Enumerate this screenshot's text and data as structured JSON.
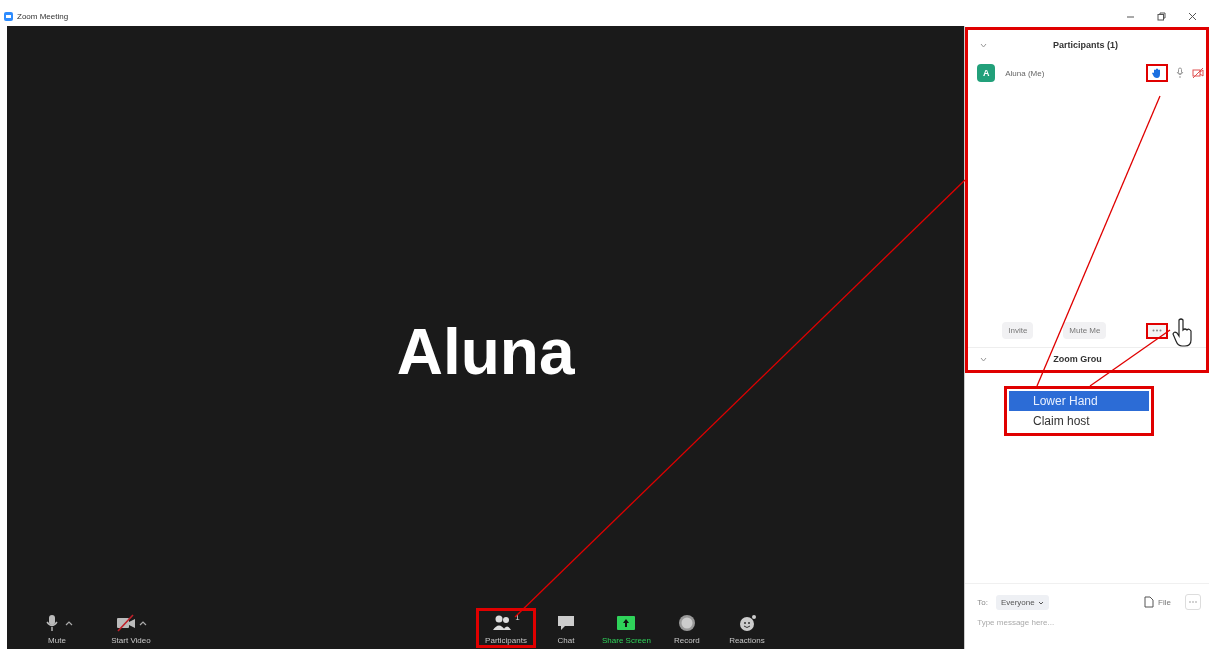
{
  "window": {
    "title": "Zoom Meeting"
  },
  "stage": {
    "name": "Aluna"
  },
  "toolbar": [
    {
      "label": "Mute",
      "kind": "mic",
      "caret": true,
      "highlighted": false
    },
    {
      "label": "Start Video",
      "kind": "video",
      "caret": true,
      "highlighted": false
    },
    {
      "label": "Participants",
      "kind": "participants",
      "count": "1",
      "caret": false,
      "highlighted": true
    },
    {
      "label": "Chat",
      "kind": "chat",
      "caret": false,
      "highlighted": false
    },
    {
      "label": "Share Screen",
      "kind": "share",
      "caret": false,
      "highlighted": false
    },
    {
      "label": "Record",
      "kind": "record",
      "caret": false,
      "highlighted": false
    },
    {
      "label": "Reactions",
      "kind": "reactions",
      "caret": false,
      "highlighted": false
    }
  ],
  "participants_panel": {
    "title": "Participants (1)",
    "participants": [
      {
        "initial": "A",
        "name": "Aluna (Me)",
        "hand_raised": true
      }
    ],
    "buttons": [
      "Invite",
      "Mute Me"
    ],
    "chat_title": "Zoom Grou"
  },
  "menu": [
    {
      "label": "Lower Hand",
      "selected": true
    },
    {
      "label": "Claim host",
      "selected": false
    }
  ],
  "chat": {
    "to_label": "To:",
    "recipient": "Everyone",
    "file": "File",
    "placeholder": "Type message here..."
  }
}
